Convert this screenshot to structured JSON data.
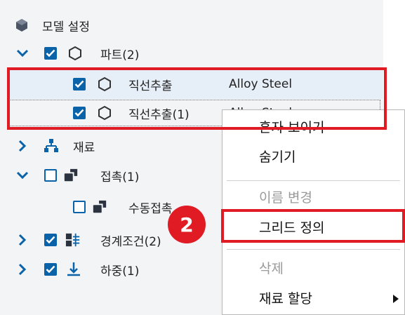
{
  "tree": {
    "model_settings": "모델 설정",
    "parts": {
      "label": "파트",
      "count": "(2)"
    },
    "part1": {
      "label": "직선추출",
      "material": "Alloy Steel"
    },
    "part2": {
      "label": "직선추출",
      "suffix": "(1)",
      "material": "Alloy Steel"
    },
    "material": "재료",
    "contacts": {
      "label": "접촉",
      "count": "(1)"
    },
    "manual_contact": "수동접촉",
    "boundary": {
      "label": "경계조건",
      "count": "(2)"
    },
    "loads": {
      "label": "하중",
      "count": "(1)"
    }
  },
  "context_menu": {
    "items": [
      {
        "label": "혼자 보이기",
        "enabled": true
      },
      {
        "label": "숨기기",
        "enabled": true
      },
      {
        "label": "이름 변경",
        "enabled": false
      },
      {
        "label": "그리드 정의",
        "enabled": true
      },
      {
        "label": "삭제",
        "enabled": false
      },
      {
        "label": "재료 할당",
        "enabled": true,
        "submenu": true
      }
    ]
  },
  "callout": {
    "number": "2"
  },
  "colors": {
    "accent": "#0a62a8",
    "highlight": "#e01b24"
  }
}
